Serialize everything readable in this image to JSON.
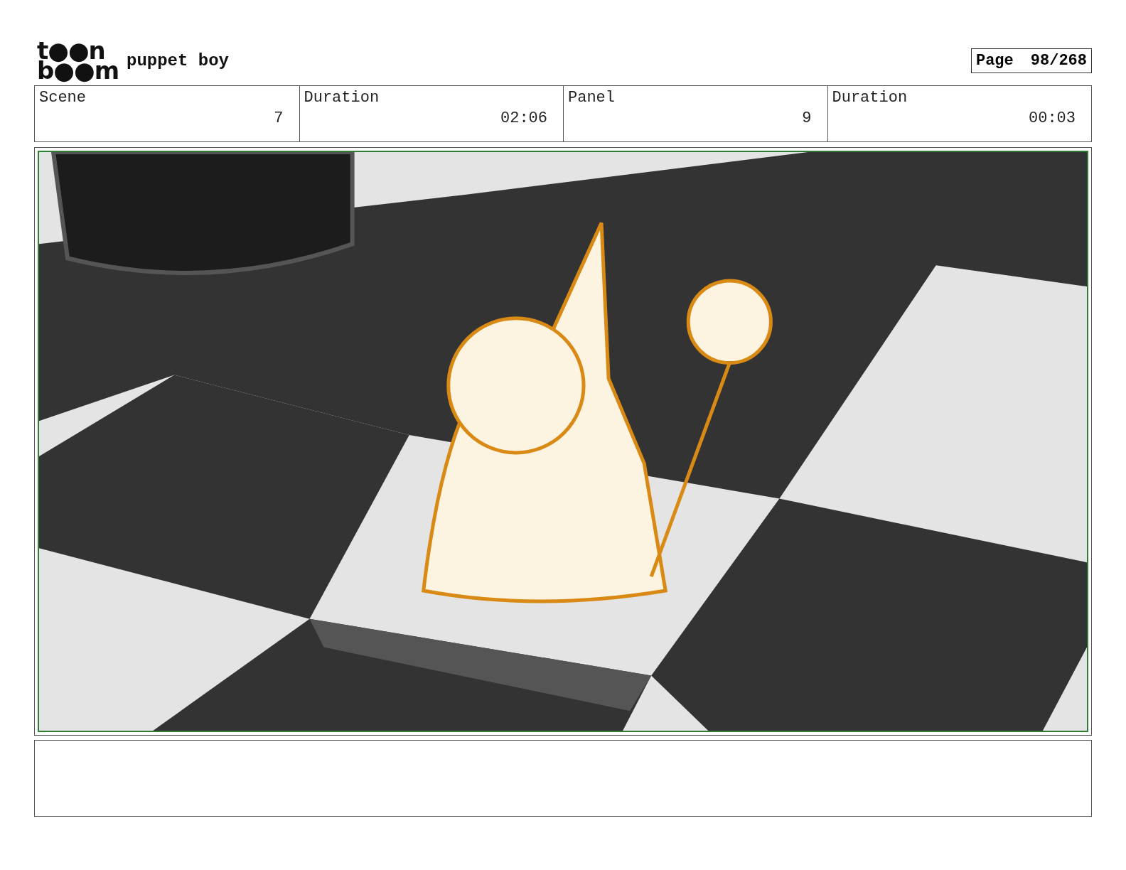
{
  "header": {
    "logo": [
      "t●●n",
      "b●●m"
    ],
    "project": "puppet boy",
    "page_label": "Page",
    "page_number": "98/268"
  },
  "info": [
    {
      "label": "Scene",
      "value": "7"
    },
    {
      "label": "Duration",
      "value": "02:06"
    },
    {
      "label": "Panel",
      "value": "9"
    },
    {
      "label": "Duration",
      "value": "00:03"
    }
  ]
}
